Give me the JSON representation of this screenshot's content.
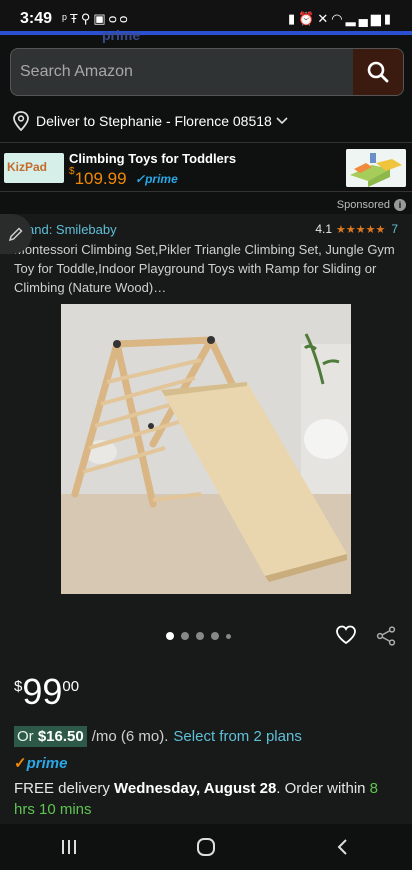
{
  "status_bar": {
    "time": "3:49",
    "left_icons": [
      "signal-icon",
      "wifi-icon",
      "walk-icon",
      "image-icon",
      "voicemail-icon"
    ],
    "right_icons": [
      "battery-saver-icon",
      "alarm-icon",
      "mute-icon",
      "wifi-icon",
      "signal-icon",
      "battery-icon"
    ]
  },
  "ghost_header": {
    "prime_text": "prime"
  },
  "search": {
    "placeholder": "Search Amazon",
    "icon": "search-icon"
  },
  "delivery_location": {
    "text": "Deliver to Stephanie - Florence 08518",
    "icon": "location-pin-icon"
  },
  "ad": {
    "logo_text": "KizPad",
    "title": "Climbing Toys for Toddlers",
    "price_symbol": "$",
    "price": "109.99",
    "prime": "prime"
  },
  "sponsored": {
    "label": "Sponsored",
    "info_icon": "info-icon"
  },
  "product": {
    "brand": "Brand: Smilebaby",
    "rating": "4.1",
    "stars": "★★★★★",
    "rating_count": "7",
    "title": "Montessori Climbing Set,Pikler Triangle Climbing Set, Jungle Gym Toy for Toddle,Indoor Playground Toys with Ramp for Sliding or Climbing (Nature Wood)…",
    "carousel_dots": 5,
    "carousel_active_index": 0,
    "price_symbol": "$",
    "price_whole": "99",
    "price_fraction": "00",
    "monthly_prefix": "Or",
    "monthly_amount": "$16.50",
    "monthly_term": "/mo (6 mo).",
    "plans_link": "Select from 2 plans",
    "prime": "prime",
    "delivery_prefix": "FREE delivery",
    "delivery_date": "Wednesday, August 28",
    "delivery_order": ". Order within",
    "delivery_within": "8 hrs 10 mins"
  },
  "colors": {
    "background": "#0f1111",
    "accent_orange": "#f08804",
    "link_blue": "#5fbfd7",
    "prime_blue": "#2aa7e6",
    "green": "#5ec451"
  }
}
